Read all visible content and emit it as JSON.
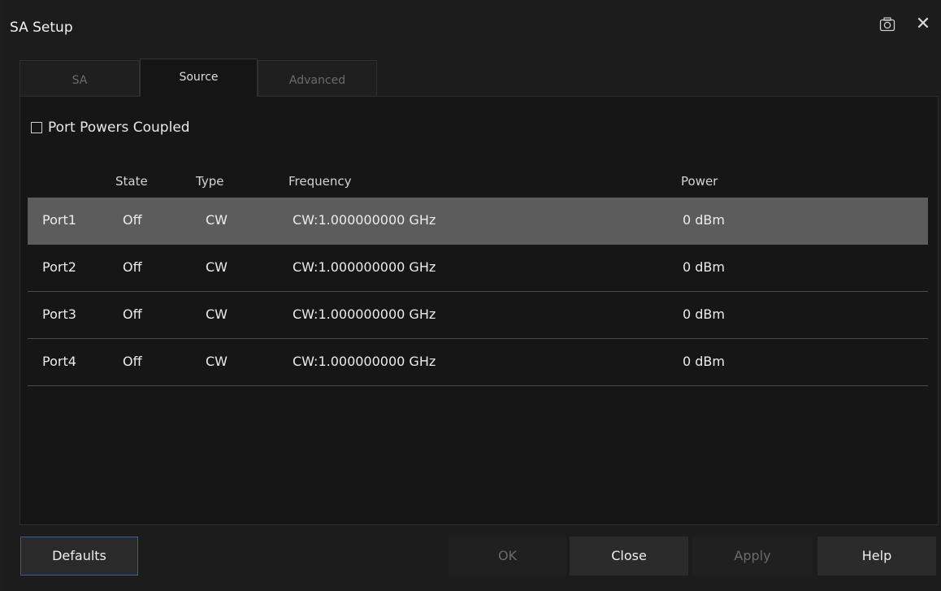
{
  "window": {
    "title": "SA Setup",
    "icons": [
      "camera-icon",
      "close-icon"
    ],
    "close_glyph": "✕"
  },
  "tabs": [
    {
      "label": "SA",
      "active": false
    },
    {
      "label": "Source",
      "active": true
    },
    {
      "label": "Advanced",
      "active": false
    }
  ],
  "port_powers_coupled": {
    "label": "Port Powers Coupled",
    "checked": false
  },
  "table": {
    "headers": {
      "state": "State",
      "type": "Type",
      "frequency": "Frequency",
      "power": "Power"
    },
    "rows": [
      {
        "port": "Port1",
        "state": "Off",
        "type": "CW",
        "frequency": "CW:1.000000000 GHz",
        "power": "0 dBm",
        "selected": true
      },
      {
        "port": "Port2",
        "state": "Off",
        "type": "CW",
        "frequency": "CW:1.000000000 GHz",
        "power": "0 dBm",
        "selected": false
      },
      {
        "port": "Port3",
        "state": "Off",
        "type": "CW",
        "frequency": "CW:1.000000000 GHz",
        "power": "0 dBm",
        "selected": false
      },
      {
        "port": "Port4",
        "state": "Off",
        "type": "CW",
        "frequency": "CW:1.000000000 GHz",
        "power": "0 dBm",
        "selected": false
      }
    ]
  },
  "buttons": {
    "defaults": "Defaults",
    "ok": "OK",
    "close": "Close",
    "apply": "Apply",
    "help": "Help"
  },
  "colors": {
    "background": "#1c1c1c",
    "selected_row": "#5c5c5c",
    "focus_border": "#2f5ea8"
  }
}
